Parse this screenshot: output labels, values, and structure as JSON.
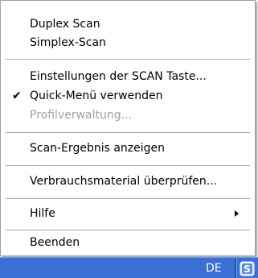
{
  "menu": {
    "items": [
      {
        "label": "Duplex Scan"
      },
      {
        "label": "Simplex-Scan"
      },
      {
        "label": "Einstellungen der SCAN Taste..."
      },
      {
        "label": "Quick-Menü verwenden",
        "checked": true
      },
      {
        "label": "Profilverwaltung...",
        "disabled": true
      },
      {
        "label": "Scan-Ergebnis anzeigen"
      },
      {
        "label": "Verbrauchsmaterial überprüfen..."
      },
      {
        "label": "Hilfe",
        "has_submenu": true
      },
      {
        "label": "Beenden"
      }
    ],
    "check_glyph": "✔"
  },
  "taskbar": {
    "language": "DE",
    "tray_icon": "scanner-tray-icon",
    "color": "#3a6fd6"
  }
}
